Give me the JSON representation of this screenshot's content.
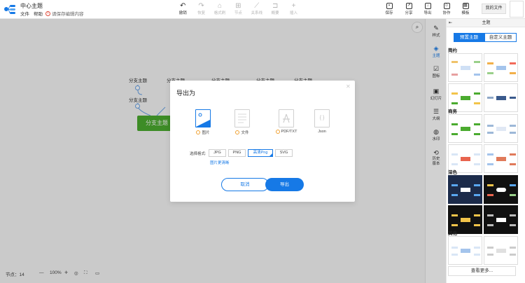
{
  "header": {
    "title": "中心主题",
    "menu": [
      "文件",
      "帮助"
    ],
    "unsaved": "请保存编辑内容",
    "toolbar": [
      {
        "label": "撤销",
        "icon": "undo-icon",
        "enabled": true
      },
      {
        "label": "恢复",
        "icon": "redo-icon",
        "enabled": false
      },
      {
        "label": "格式刷",
        "icon": "format-brush-icon",
        "enabled": false
      },
      {
        "label": "节点",
        "icon": "node-icon",
        "enabled": false
      },
      {
        "label": "关系线",
        "icon": "relation-line-icon",
        "enabled": false
      },
      {
        "label": "概要",
        "icon": "summary-icon",
        "enabled": false
      },
      {
        "label": "插入",
        "icon": "insert-icon",
        "enabled": false
      }
    ],
    "actions": [
      {
        "label": "保存",
        "icon": "save-icon"
      },
      {
        "label": "分享",
        "icon": "share-icon"
      },
      {
        "label": "导出",
        "icon": "export-icon"
      },
      {
        "label": "协作",
        "icon": "collaborate-icon"
      },
      {
        "label": "模板",
        "icon": "template-icon"
      }
    ],
    "my_files": "我的文件"
  },
  "canvas": {
    "main_node": "分支主题",
    "branch_nodes": [
      "分支主题",
      "分支主题",
      "分支主题",
      "分支主题",
      "分支主题",
      "分支主题"
    ]
  },
  "statusbar": {
    "node_count_label": "节点：14",
    "zoom": "100%"
  },
  "sidetabs": [
    {
      "label": "样式",
      "icon": "style-icon",
      "active": false
    },
    {
      "label": "主题",
      "icon": "theme-icon",
      "active": true
    },
    {
      "label": "图标",
      "icon": "icon-library-icon",
      "active": false
    },
    {
      "label": "幻灯片",
      "icon": "slides-icon",
      "active": false
    },
    {
      "label": "大纲",
      "icon": "outline-icon",
      "active": false
    },
    {
      "label": "水印",
      "icon": "watermark-icon",
      "active": false
    },
    {
      "label": "历史版本",
      "icon": "history-icon",
      "active": false
    }
  ],
  "theme_panel": {
    "title": "主题",
    "tabs": [
      "预置主题",
      "自定义主题"
    ],
    "categories": [
      "简约",
      "商务",
      "深色",
      "其他"
    ],
    "more": "查看更多..."
  },
  "dialog": {
    "title": "导出为",
    "formats": [
      {
        "label": "图片",
        "active": true
      },
      {
        "label": "文件",
        "active": false
      },
      {
        "label": "PDF/TXT",
        "active": false
      },
      {
        "label": "Json",
        "active": false
      }
    ],
    "option_label": "选择格式:",
    "options": [
      "JPG",
      "PNG",
      "高清Png",
      "SVG"
    ],
    "selected_option": "高清Png",
    "hq_link": "图片更清晰",
    "cancel": "取消",
    "export": "导出"
  },
  "colors": {
    "accent": "#1679e6",
    "main_node": "#4bab2f"
  }
}
